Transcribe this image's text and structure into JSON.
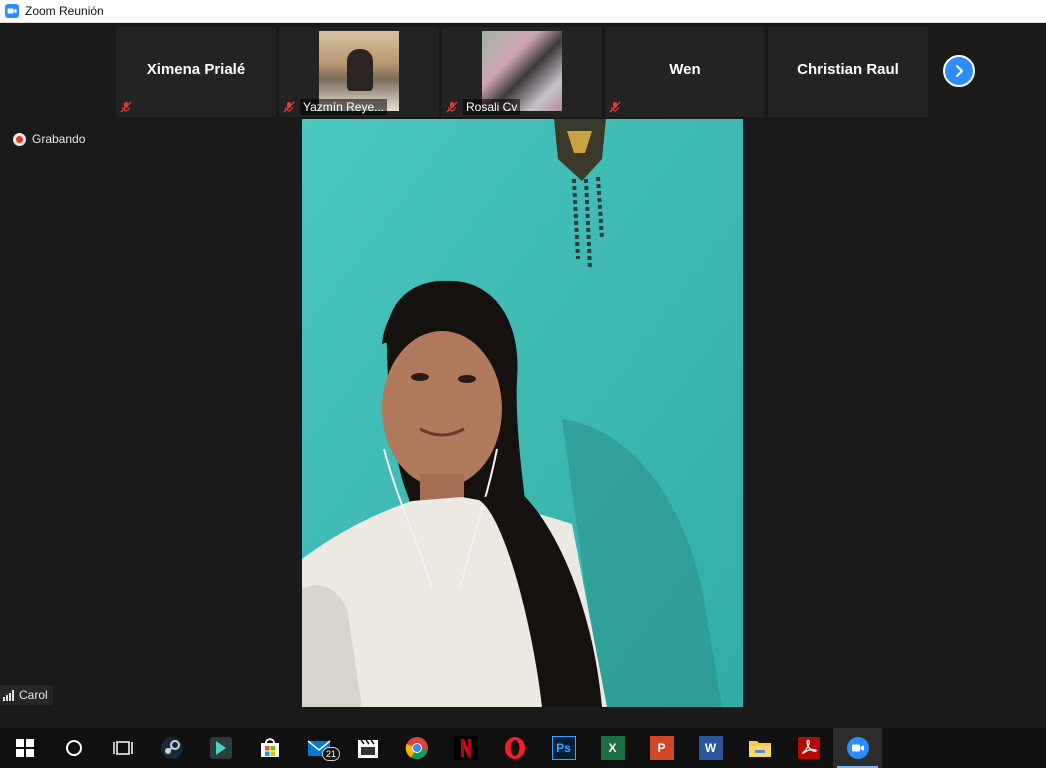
{
  "window": {
    "title": "Zoom Reunión"
  },
  "participants": [
    {
      "name": "Ximena Prialé",
      "has_video": false
    },
    {
      "name": "Yazmín Reye...",
      "has_video": true
    },
    {
      "name": "Rosali Cv",
      "has_video": true
    },
    {
      "name": "Wen",
      "has_video": false
    },
    {
      "name": "Christian Raul",
      "has_video": false
    }
  ],
  "recording": {
    "label": "Grabando"
  },
  "self_view": {
    "name": "Carol"
  },
  "taskbar": {
    "mail_badge": "21",
    "icons": [
      "windows-start-icon",
      "cortana-search-icon",
      "task-view-icon",
      "steam-icon",
      "filmora-icon",
      "microsoft-store-icon",
      "mail-icon",
      "movies-tv-icon",
      "chrome-icon",
      "netflix-icon",
      "opera-icon",
      "photoshop-icon",
      "excel-icon",
      "powerpoint-icon",
      "word-icon",
      "file-explorer-icon",
      "adobe-reader-icon",
      "zoom-icon"
    ]
  },
  "colors": {
    "accent": "#2d8cff",
    "recording": "#e0392d",
    "video_wall": "#3fbcb6"
  }
}
